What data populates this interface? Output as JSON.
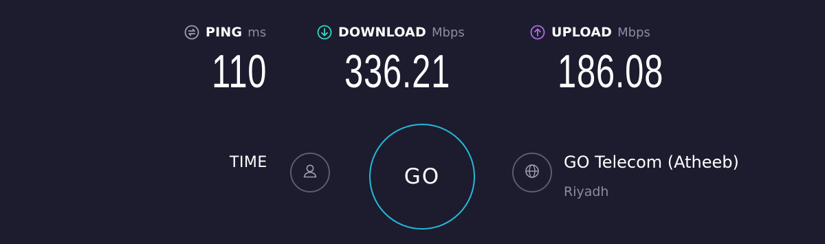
{
  "metrics": {
    "ping": {
      "label": "PING",
      "unit": "ms",
      "value": "110",
      "icon": "ping-icon",
      "color": "#9e9eb4"
    },
    "download": {
      "label": "DOWNLOAD",
      "unit": "Mbps",
      "value": "336.21",
      "icon": "download-arrow-icon",
      "color": "#36d6c8"
    },
    "upload": {
      "label": "UPLOAD",
      "unit": "Mbps",
      "value": "186.08",
      "icon": "upload-arrow-icon",
      "color": "#b06ee0"
    }
  },
  "controls": {
    "time_label": "TIME",
    "go_label": "GO",
    "user_icon": "user-icon",
    "globe_icon": "globe-icon",
    "go_ring_color": "#26b8d8"
  },
  "server": {
    "isp": "GO Telecom (Atheeb)",
    "location": "Riyadh"
  },
  "colors": {
    "background": "#1c1c2e",
    "muted_text": "#8c8ca3",
    "button_border": "#5c5c72"
  }
}
